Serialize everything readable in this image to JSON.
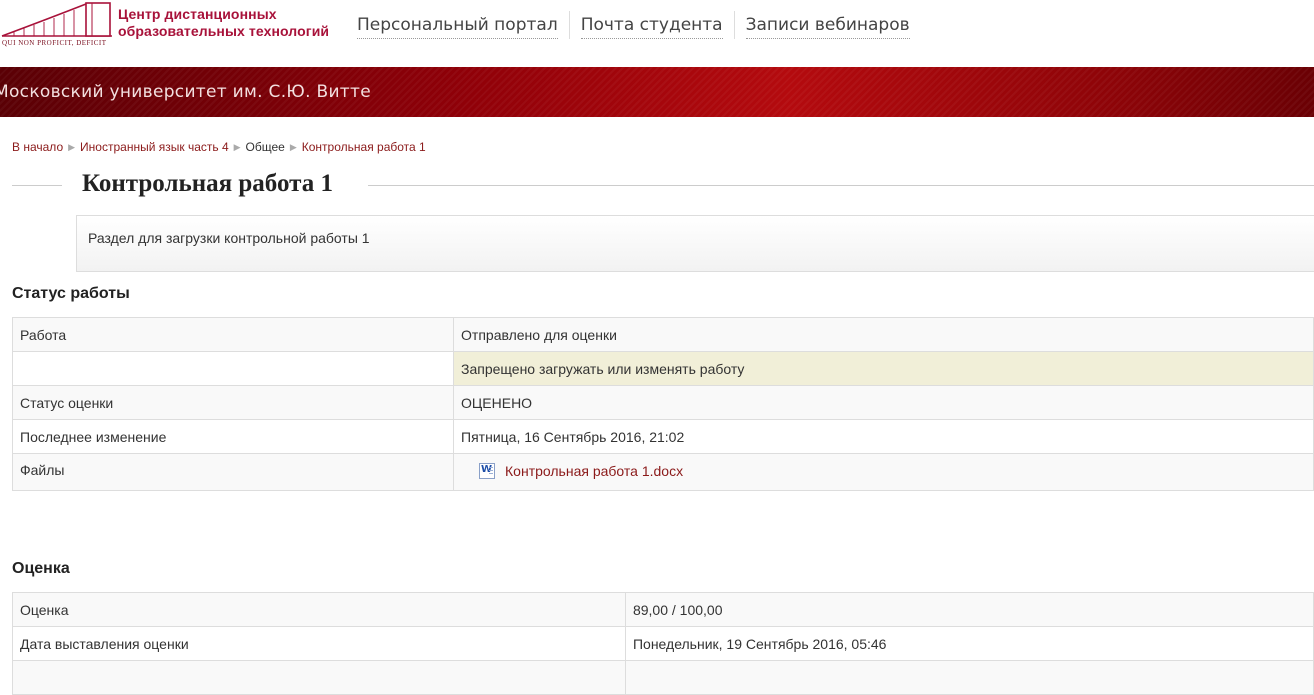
{
  "header": {
    "logo_title_line1": "Центр дистанционных",
    "logo_title_line2": "образовательных технологий",
    "logo_motto": "QUI NON PROFICIT, DEFICIT",
    "nav": [
      {
        "label": "Персональный портал"
      },
      {
        "label": "Почта студента"
      },
      {
        "label": "Записи вебинаров"
      }
    ]
  },
  "banner": {
    "title": "Московский университет им. С.Ю. Витте"
  },
  "breadcrumb": {
    "items": [
      {
        "label": "В начало"
      },
      {
        "label": "Иностранный язык часть 4"
      },
      {
        "label": "Общее"
      },
      {
        "label": "Контрольная работа 1"
      }
    ]
  },
  "page": {
    "title": "Контрольная работа 1",
    "intro": "Раздел для загрузки контрольной работы 1"
  },
  "status": {
    "title": "Статус работы",
    "rows": [
      {
        "label": "Работа",
        "value": "Отправлено для оценки"
      },
      {
        "label": "",
        "value": "Запрещено загружать или изменять работу"
      },
      {
        "label": "Статус оценки",
        "value": "ОЦЕНЕНО"
      },
      {
        "label": "Последнее изменение",
        "value": "Пятница, 16 Сентябрь 2016, 21:02"
      },
      {
        "label": "Файлы",
        "file": "Контрольная работа 1.docx",
        "file_icon": "word-document-icon"
      }
    ]
  },
  "grade": {
    "title": "Оценка",
    "rows": [
      {
        "label": "Оценка",
        "value": "89,00 / 100,00"
      },
      {
        "label": "Дата выставления оценки",
        "value": "Понедельник, 19 Сентябрь 2016, 05:46"
      },
      {
        "label": "",
        "value": ""
      }
    ]
  },
  "colors": {
    "brand_red": "#a8123a",
    "banner_dark": "#5a0005",
    "banner_light": "#b40a0e",
    "link": "#8b1a1a",
    "warning_bg": "#f1efd8"
  }
}
